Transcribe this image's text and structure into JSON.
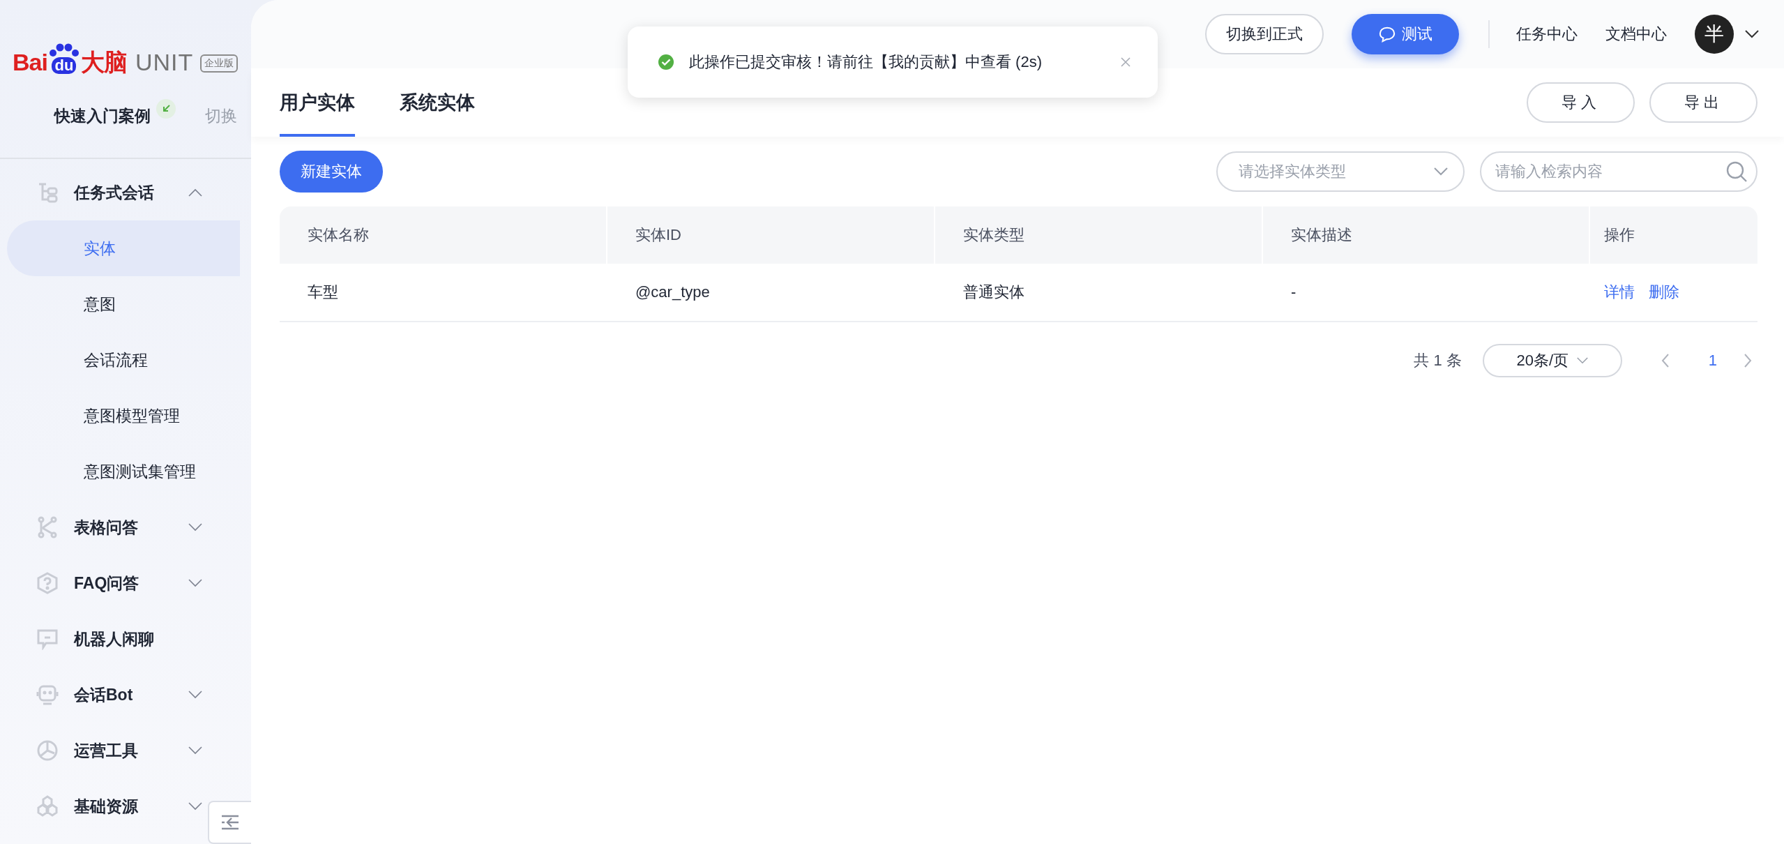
{
  "logo": {
    "brand_left": "Bai",
    "brand_mark": "du",
    "brand_cn": "大脑",
    "product": "UNIT",
    "edition": "企业版"
  },
  "project": {
    "name": "快速入门案例",
    "switch_label": "切换"
  },
  "sidebar": {
    "items": [
      {
        "label": "任务式会话",
        "kind": "group",
        "expanded": true,
        "children": [
          {
            "label": "实体",
            "selected": true
          },
          {
            "label": "意图",
            "selected": false
          },
          {
            "label": "会话流程",
            "selected": false
          },
          {
            "label": "意图模型管理",
            "selected": false
          },
          {
            "label": "意图测试集管理",
            "selected": false
          }
        ]
      },
      {
        "label": "表格问答",
        "kind": "group",
        "expanded": false
      },
      {
        "label": "FAQ问答",
        "kind": "group",
        "expanded": false
      },
      {
        "label": "机器人闲聊",
        "kind": "link"
      },
      {
        "label": "会话Bot",
        "kind": "group",
        "expanded": false
      },
      {
        "label": "运营工具",
        "kind": "group",
        "expanded": false
      },
      {
        "label": "基础资源",
        "kind": "group",
        "expanded": false
      }
    ]
  },
  "header": {
    "switch_button": "切换到正式",
    "test_button": "测试",
    "links": [
      "任务中心",
      "文档中心"
    ],
    "avatar": "半"
  },
  "toast": {
    "message": "此操作已提交审核！请前往【我的贡献】中查看 (2s)"
  },
  "tabs": [
    {
      "label": "用户实体",
      "selected": true
    },
    {
      "label": "系统实体",
      "selected": false
    }
  ],
  "tab_actions": [
    "导入",
    "导出"
  ],
  "toolbar": {
    "new_button": "新建实体",
    "type_select": {
      "placeholder": "请选择实体类型"
    },
    "search": {
      "placeholder": "请输入检索内容"
    }
  },
  "table": {
    "columns": [
      "实体名称",
      "实体ID",
      "实体类型",
      "实体描述",
      "操作"
    ],
    "rows": [
      {
        "cells": [
          "车型",
          "@car_type",
          "普通实体",
          "-"
        ],
        "actions": [
          "详情",
          "删除"
        ]
      }
    ]
  },
  "pagination": {
    "total": "共 1 条",
    "page_size": "20条/页",
    "pages": [
      {
        "label": "1",
        "selected": true
      }
    ]
  }
}
